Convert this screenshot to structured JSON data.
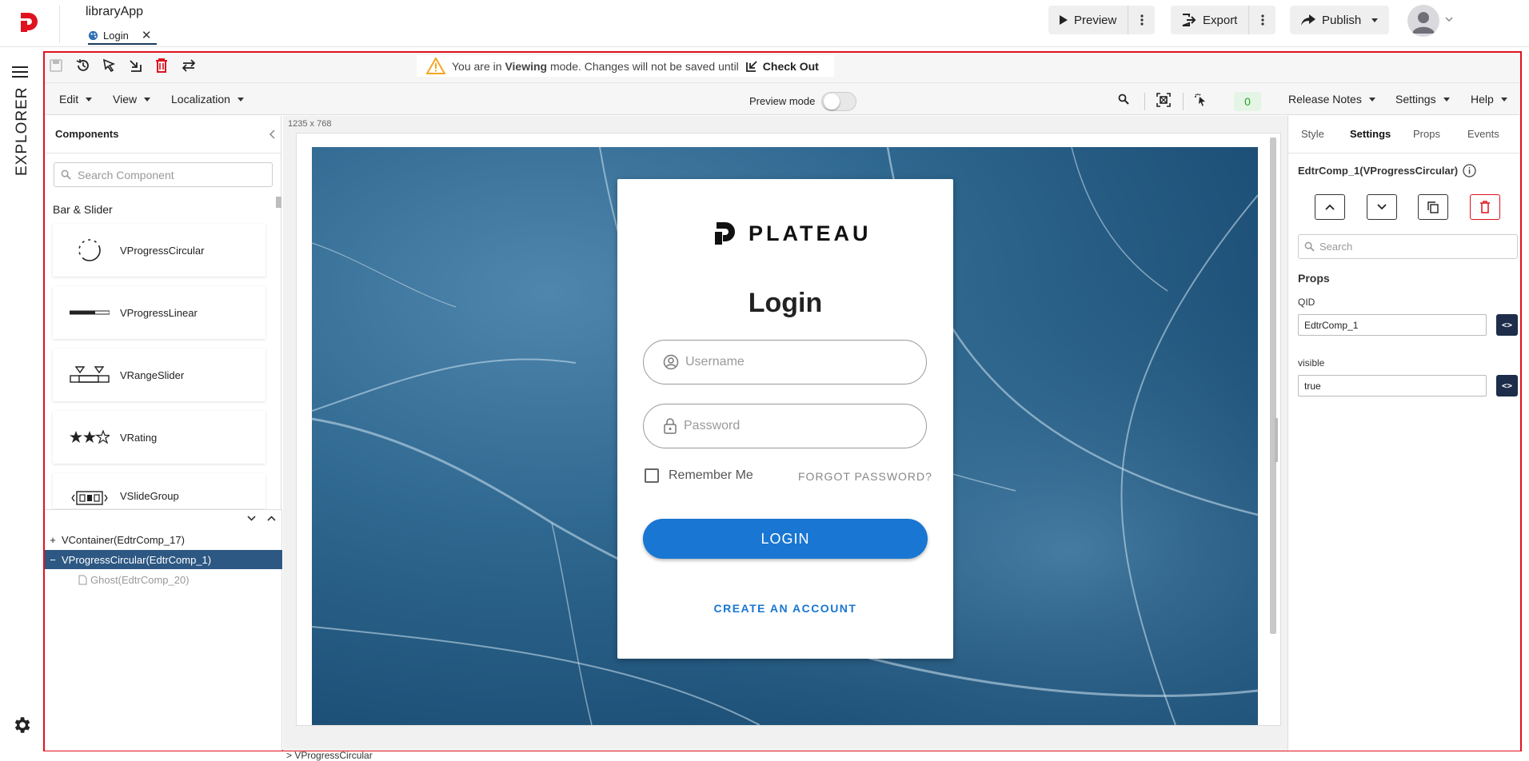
{
  "header": {
    "app_name": "libraryApp",
    "file_tab": "Login",
    "preview_label": "Preview",
    "export_label": "Export",
    "publish_label": "Publish"
  },
  "rail": {
    "explorer_label": "EXPLORER"
  },
  "toolbar": {
    "banner_prefix": "You are in",
    "banner_mode": "Viewing",
    "banner_suffix": "mode. Changes will not be saved until",
    "checkout_label": "Check Out",
    "menus": [
      "Edit",
      "View",
      "Localization"
    ],
    "preview_mode_label": "Preview mode",
    "counter": "0",
    "right_menus": [
      "Release Notes",
      "Settings",
      "Help"
    ]
  },
  "components": {
    "title": "Components",
    "search_placeholder": "Search Component",
    "category": "Bar & Slider",
    "items": [
      "VProgressCircular",
      "VProgressLinear",
      "VRangeSlider",
      "VRating",
      "VSlideGroup"
    ]
  },
  "tree": {
    "rows": [
      {
        "prefix": "+",
        "label": "VContainer(EdtrComp_17)"
      },
      {
        "prefix": "−",
        "label": "VProgressCircular(EdtrComp_1)"
      },
      {
        "prefix": "",
        "label": "Ghost(EdtrComp_20)"
      }
    ]
  },
  "canvas": {
    "size_label": "1235 x 768",
    "brand": "PLATEAU",
    "title": "Login",
    "username_placeholder": "Username",
    "password_placeholder": "Password",
    "remember_label": "Remember Me",
    "forgot_label": "FORGOT PASSWORD?",
    "login_button": "LOGIN",
    "create_account": "CREATE AN ACCOUNT"
  },
  "status": {
    "breadcrumb": "> VProgressCircular"
  },
  "right_panel": {
    "tabs": [
      "Style",
      "Settings",
      "Props",
      "Events"
    ],
    "active_tab": "Settings",
    "component_title": "EdtrComp_1(VProgressCircular)",
    "search_placeholder": "Search",
    "section": "Props",
    "qid_label": "QID",
    "qid_value": "EdtrComp_1",
    "visible_label": "visible",
    "visible_value": "true"
  },
  "colors": {
    "accent_red": "#e0121f",
    "selection_blue": "#2d5883",
    "primary_blue": "#1976d2",
    "counter_green": "#23a323"
  }
}
